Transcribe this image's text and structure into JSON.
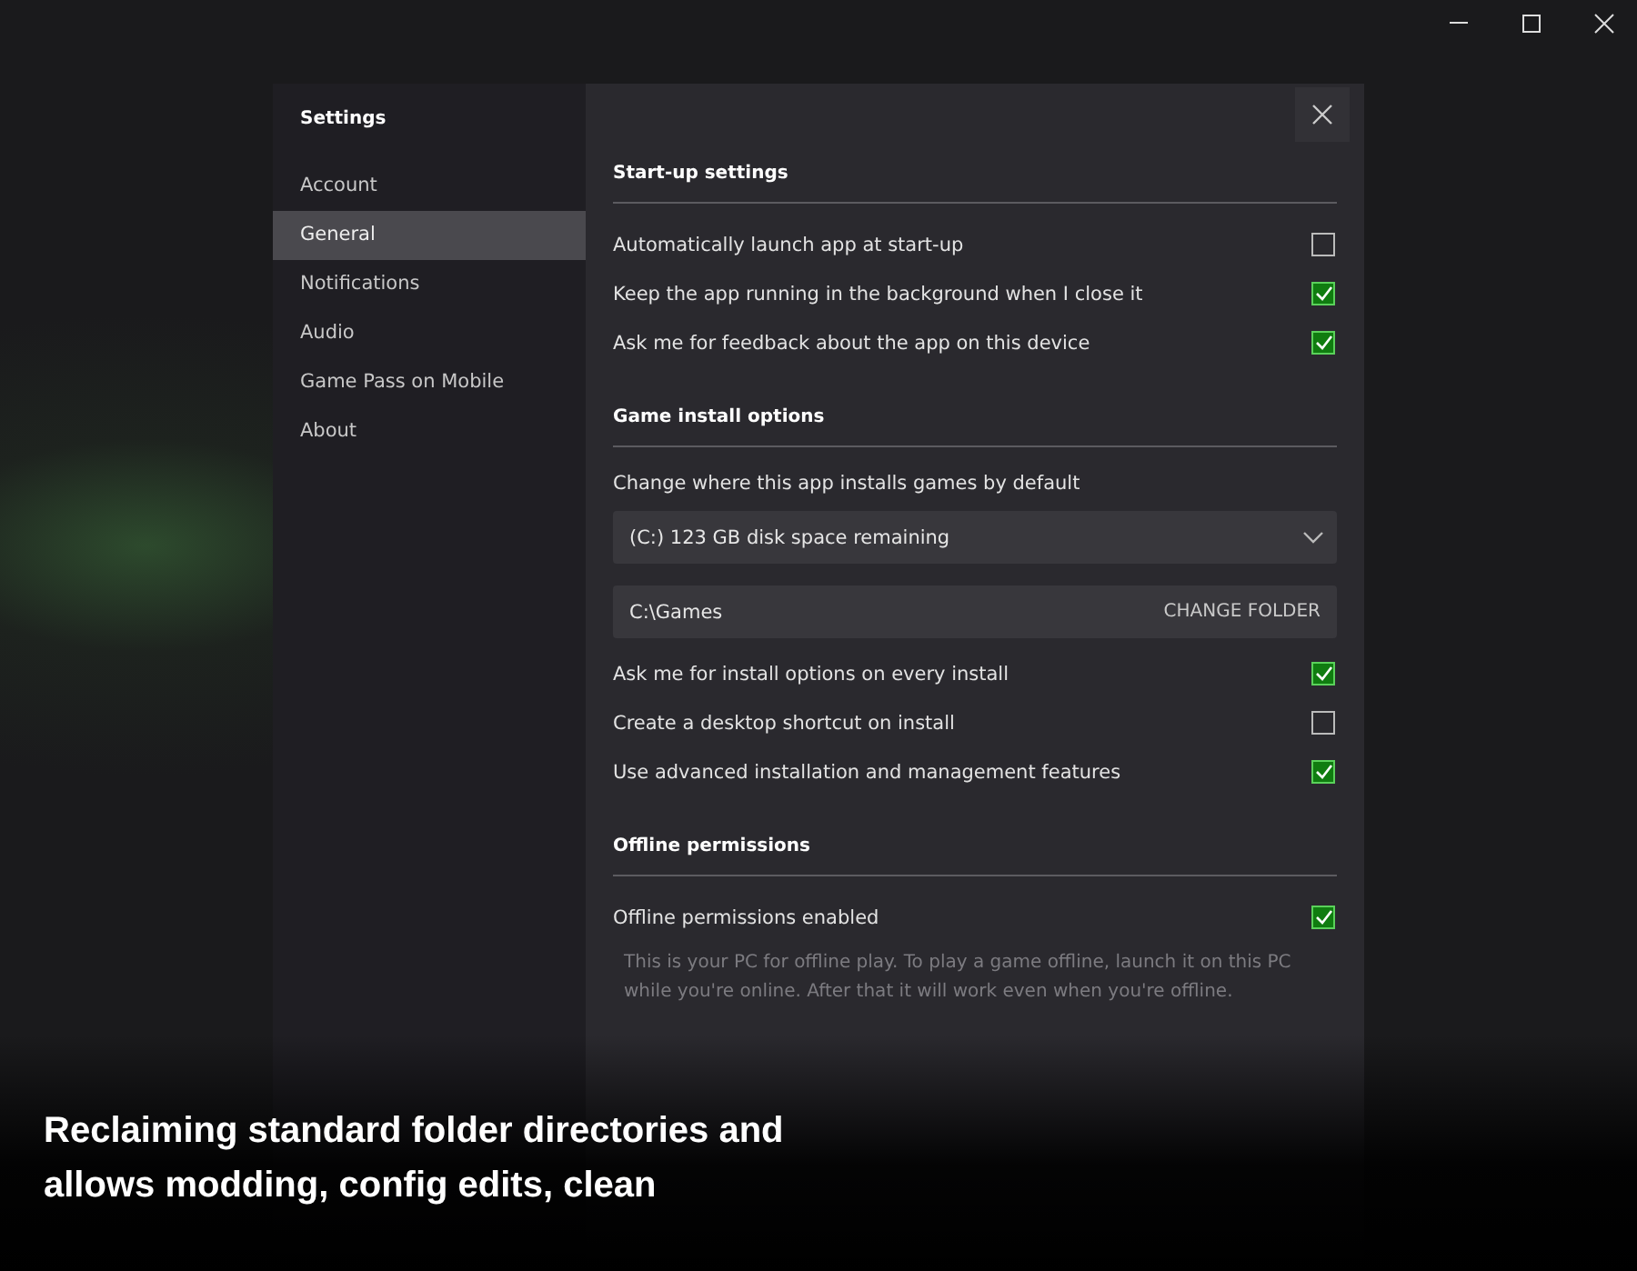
{
  "sidebar": {
    "title": "Settings",
    "items": [
      {
        "label": "Account",
        "selected": false
      },
      {
        "label": "General",
        "selected": true
      },
      {
        "label": "Notifications",
        "selected": false
      },
      {
        "label": "Audio",
        "selected": false
      },
      {
        "label": "Game Pass on Mobile",
        "selected": false
      },
      {
        "label": "About",
        "selected": false
      }
    ]
  },
  "sections": [
    {
      "title": "Start-up settings",
      "rows": [
        {
          "kind": "checkbox",
          "label": "Automatically launch app at start-up",
          "checked": false
        },
        {
          "kind": "checkbox",
          "label": "Keep the app running in the background when I close it",
          "checked": true
        },
        {
          "kind": "checkbox",
          "label": "Ask me for feedback about the app on this device",
          "checked": true
        }
      ]
    },
    {
      "title": "Game install options",
      "rows": [
        {
          "kind": "label",
          "label": "Change where this app installs games by default"
        },
        {
          "kind": "dropdown",
          "label": "(C:) 123 GB disk space remaining"
        },
        {
          "kind": "folder",
          "label": "C:\\Games",
          "button": "CHANGE FOLDER"
        },
        {
          "kind": "checkbox",
          "label": "Ask me for install options on every install",
          "checked": true
        },
        {
          "kind": "checkbox",
          "label": "Create a desktop shortcut on install",
          "checked": false
        },
        {
          "kind": "checkbox",
          "label": "Use advanced installation and management features",
          "checked": true
        }
      ]
    },
    {
      "title": "Offline permissions",
      "rows": [
        {
          "kind": "checkbox",
          "label": "Offline permissions enabled",
          "checked": true
        },
        {
          "kind": "note",
          "label": "This is your PC for offline play. To play a game offline, launch it on this PC while you're online. After that it will work even when you're offline."
        }
      ]
    }
  ],
  "caption": [
    "Reclaiming standard folder directories and",
    "allows modding, config edits, clean"
  ]
}
